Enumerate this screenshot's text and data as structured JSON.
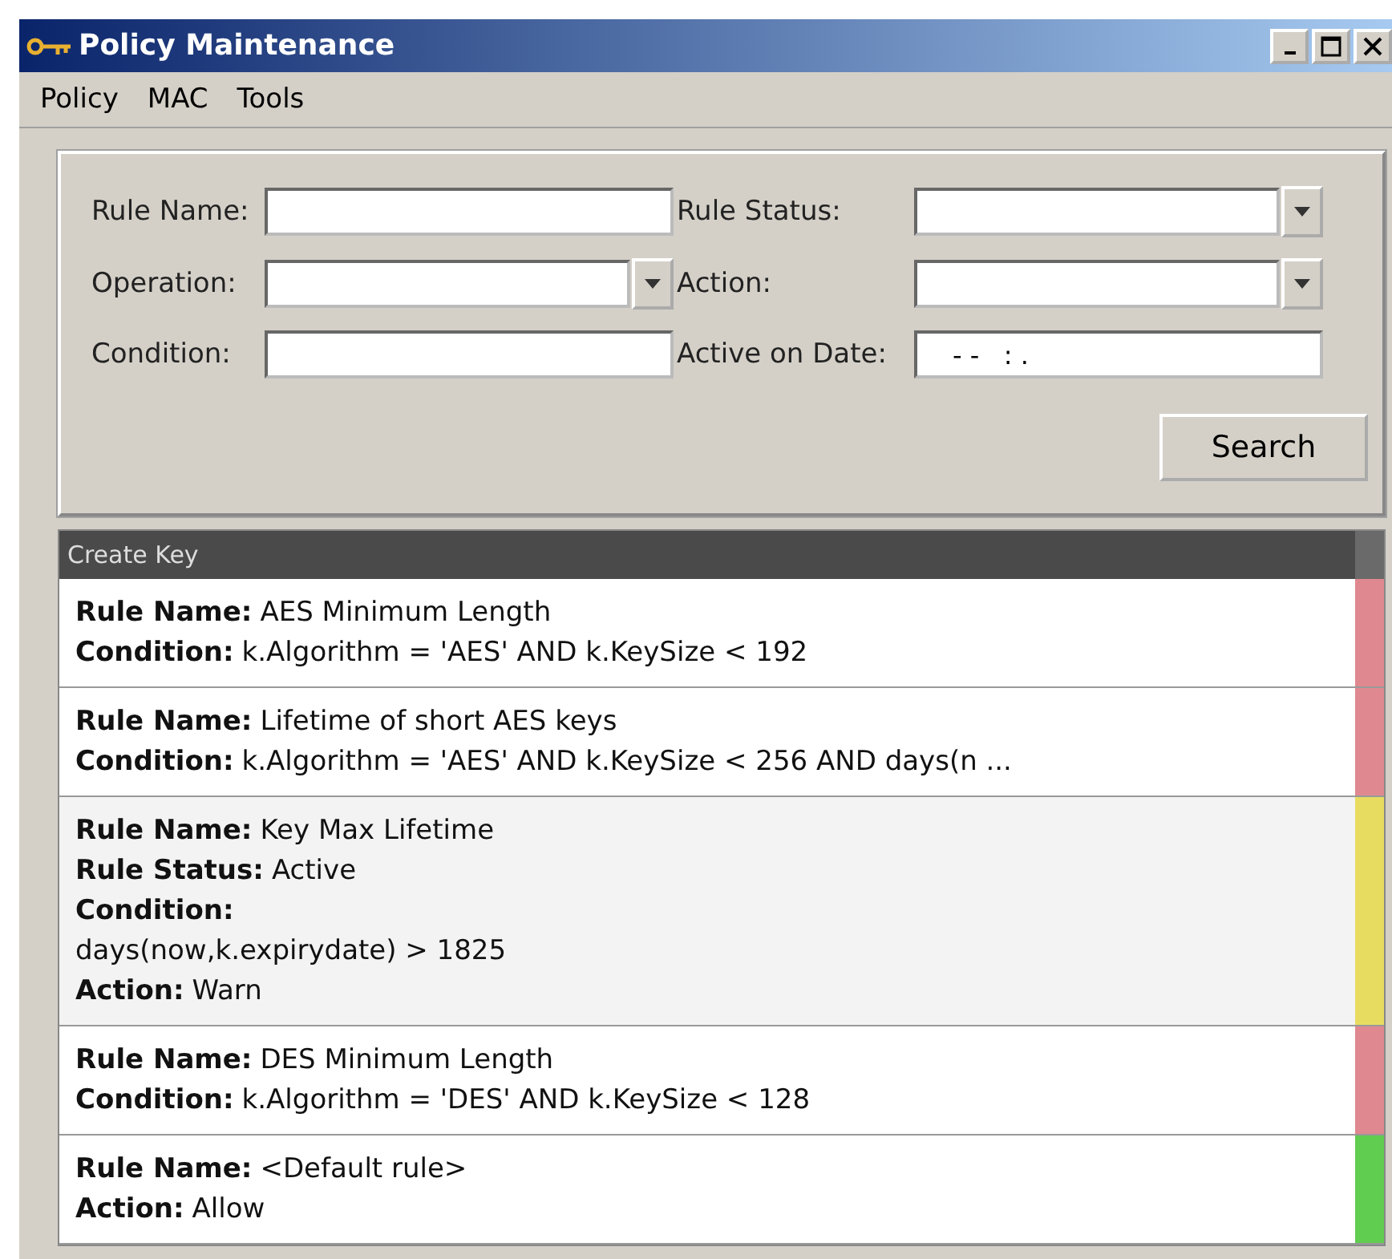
{
  "window": {
    "title": "Policy Maintenance"
  },
  "menu": [
    {
      "label": "Policy"
    },
    {
      "label": "MAC"
    },
    {
      "label": "Tools"
    }
  ],
  "search_form": {
    "fields": [
      {
        "label": "Rule Name:",
        "kind": "text"
      },
      {
        "label": "Rule Status:",
        "kind": "combo"
      },
      {
        "label": "Operation:",
        "kind": "combo"
      },
      {
        "label": "Action:",
        "kind": "combo"
      },
      {
        "label": "Condition:",
        "kind": "text"
      },
      {
        "label": "Active on Date:",
        "kind": "date",
        "value": "- -   : ."
      }
    ],
    "button": "Search"
  },
  "rule_list": {
    "group": "Create Key",
    "rules": [
      {
        "selected": false,
        "color": "#e08890",
        "fields": [
          {
            "label": "Rule Name:",
            "value": "AES Minimum Length",
            "kind": "inline"
          },
          {
            "label": "Condition:",
            "value": "k.Algorithm = 'AES' AND k.KeySize < 192",
            "kind": "inline"
          }
        ]
      },
      {
        "selected": false,
        "color": "#e08890",
        "fields": [
          {
            "label": "Rule Name:",
            "value": "Lifetime of short AES keys",
            "kind": "inline"
          },
          {
            "label": "Condition:",
            "value": "k.Algorithm = 'AES' AND k.KeySize < 256 AND days(n ...",
            "kind": "inline"
          }
        ]
      },
      {
        "selected": true,
        "color": "#e8dc60",
        "fields": [
          {
            "label": "Rule Name:",
            "value": "Key Max Lifetime",
            "kind": "inline"
          },
          {
            "label": "Rule Status:",
            "value": "Active",
            "kind": "inline"
          },
          {
            "label": "Condition:",
            "value": "days(now,k.expirydate) > 1825",
            "kind": "block"
          },
          {
            "label": "Action:",
            "value": "Warn",
            "kind": "inline"
          }
        ]
      },
      {
        "selected": false,
        "color": "#e08890",
        "fields": [
          {
            "label": "Rule Name:",
            "value": "DES Minimum Length",
            "kind": "inline"
          },
          {
            "label": "Condition:",
            "value": "k.Algorithm = 'DES' AND k.KeySize < 128",
            "kind": "inline"
          }
        ]
      },
      {
        "selected": false,
        "color": "#60cc50",
        "fields": [
          {
            "label": "Rule Name:",
            "value": "<Default rule>",
            "kind": "inline"
          },
          {
            "label": "Action:",
            "value": "Allow",
            "kind": "inline"
          }
        ]
      }
    ]
  }
}
